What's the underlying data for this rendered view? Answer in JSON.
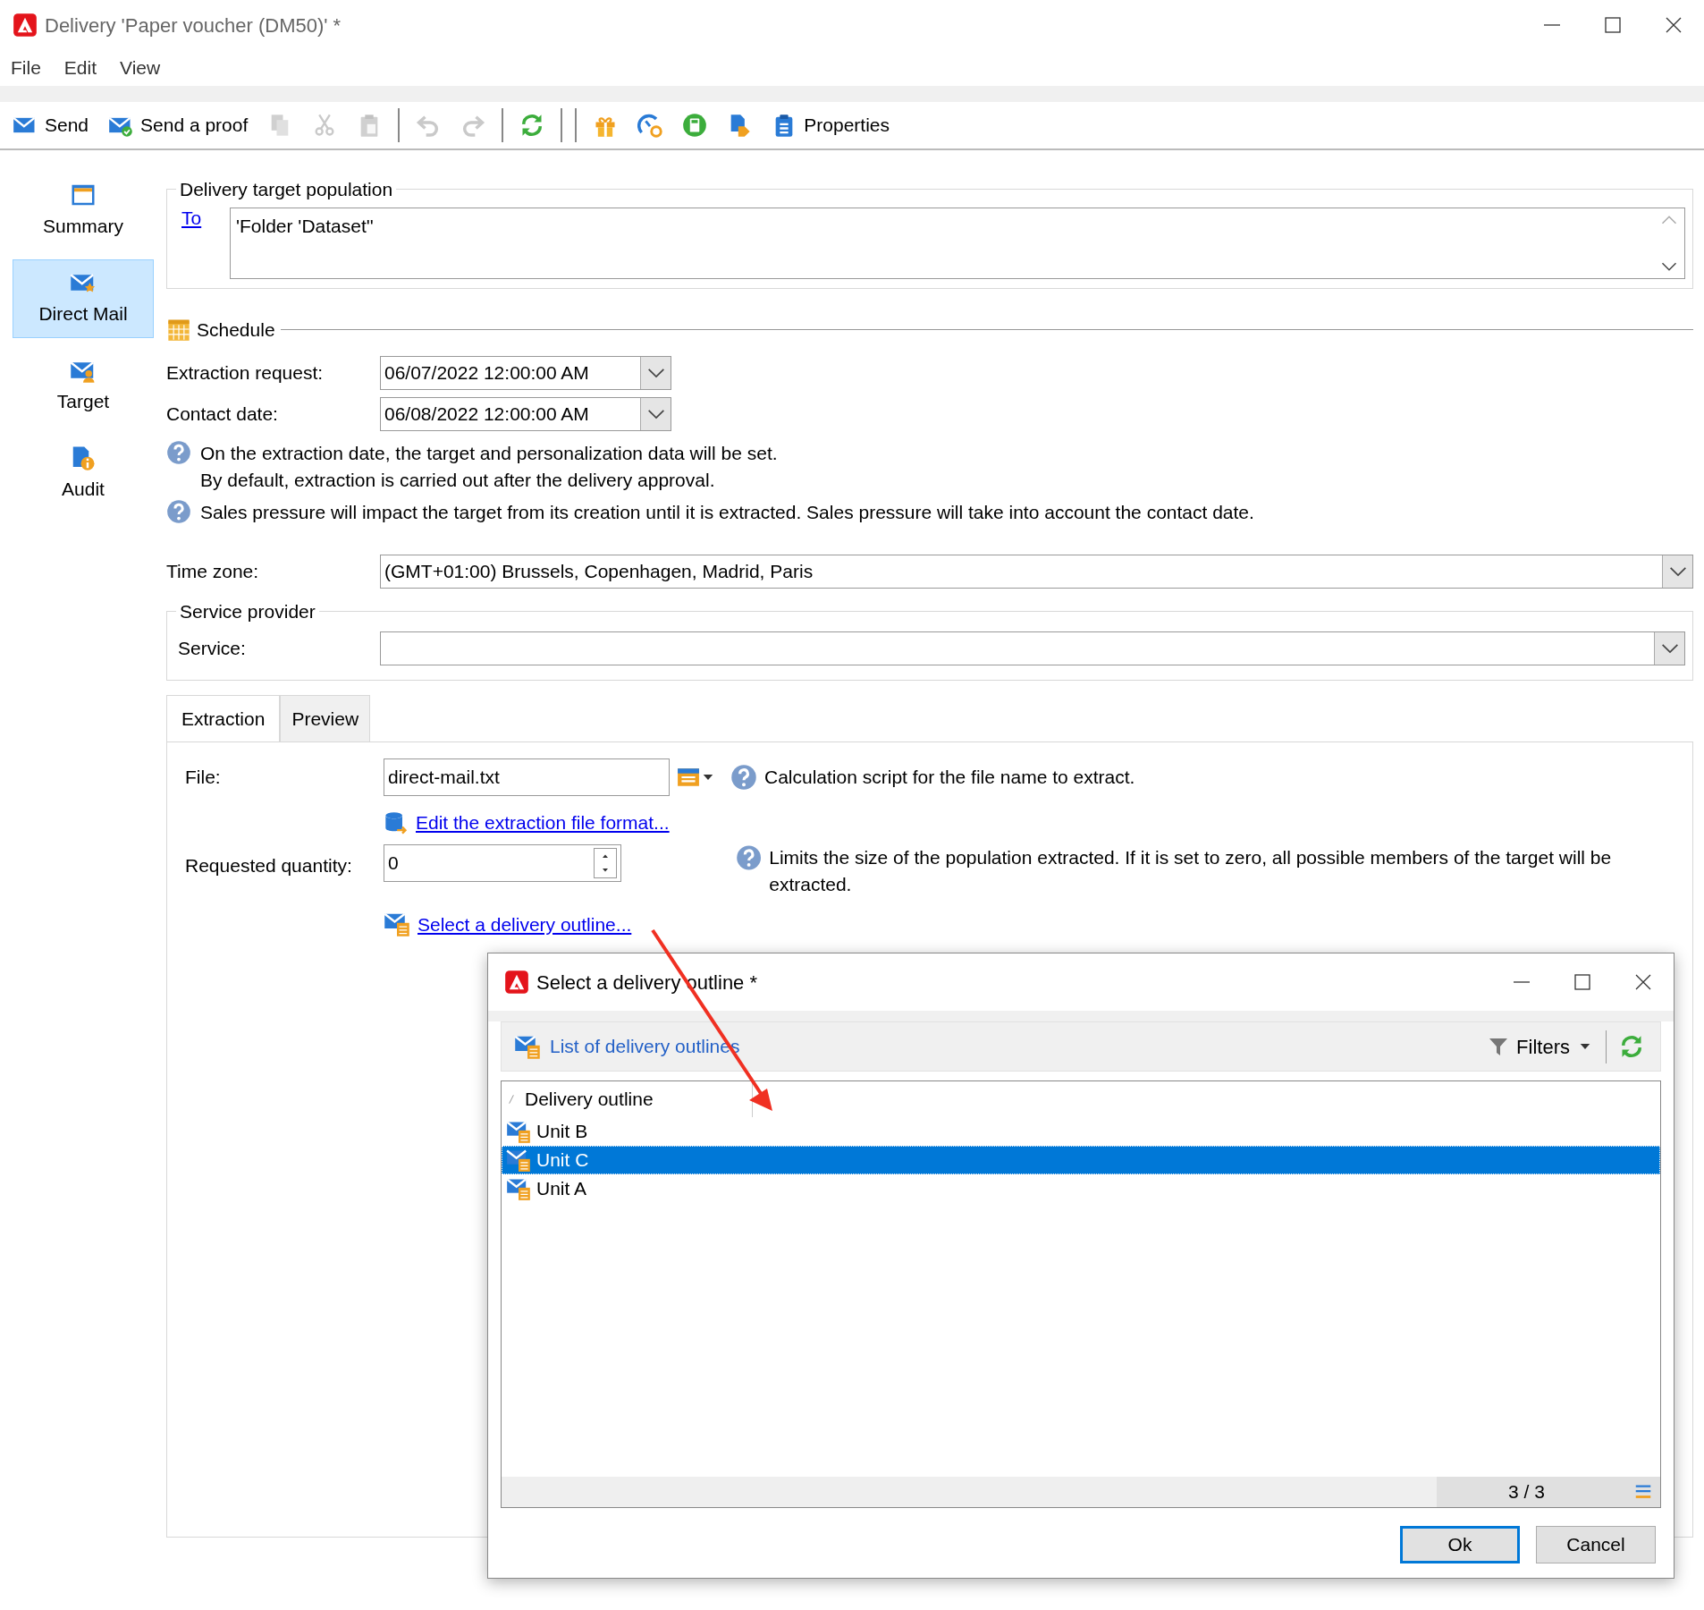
{
  "window": {
    "title": "Delivery 'Paper voucher (DM50)' *"
  },
  "menu": [
    "File",
    "Edit",
    "View"
  ],
  "toolbar": [
    {
      "kind": "labeled",
      "label": "Send",
      "disabled": false
    },
    {
      "kind": "labeled",
      "label": "Send a proof",
      "disabled": false
    },
    {
      "kind": "icon",
      "disabled": true
    },
    {
      "kind": "icon",
      "disabled": true
    },
    {
      "kind": "icon",
      "disabled": true
    },
    {
      "kind": "separator"
    },
    {
      "kind": "icon",
      "disabled": true
    },
    {
      "kind": "icon",
      "disabled": true
    },
    {
      "kind": "separator"
    },
    {
      "kind": "icon",
      "disabled": false
    },
    {
      "kind": "separator"
    },
    {
      "kind": "separator"
    },
    {
      "kind": "icon",
      "disabled": false
    },
    {
      "kind": "icon",
      "disabled": false
    },
    {
      "kind": "icon",
      "disabled": false
    },
    {
      "kind": "icon",
      "disabled": false
    },
    {
      "kind": "labeled",
      "label": "Properties",
      "disabled": false
    }
  ],
  "sidebar": {
    "items": [
      {
        "label": "Summary",
        "selected": false
      },
      {
        "label": "Direct Mail",
        "selected": true
      },
      {
        "label": "Target",
        "selected": false
      },
      {
        "label": "Audit",
        "selected": false
      }
    ]
  },
  "target_population": {
    "legend": "Delivery target population",
    "link": "To",
    "value": "'Folder 'Dataset''"
  },
  "schedule": {
    "title": "Schedule",
    "fields": [
      {
        "label": "Extraction request:",
        "value": "06/07/2022 12:00:00 AM"
      },
      {
        "label": "Contact date:",
        "value": "06/08/2022 12:00:00 AM"
      }
    ],
    "notes": [
      "On the extraction date, the target and personalization data will be set.\nBy default, extraction is carried out after the delivery approval.",
      "Sales pressure will impact the target from its creation until it is extracted. Sales pressure will take into account the contact date."
    ]
  },
  "time_zone": {
    "label": "Time zone:",
    "value": "(GMT+01:00) Brussels, Copenhagen, Madrid, Paris"
  },
  "service_provider": {
    "legend": "Service provider",
    "label": "Service:"
  },
  "tabs": [
    {
      "label": "Extraction",
      "selected": true
    },
    {
      "label": "Preview",
      "selected": false
    }
  ],
  "extraction": {
    "file_label": "File:",
    "file_value": "direct-mail.txt",
    "file_help": "Calculation script for the file name to extract.",
    "format_link": "Edit the extraction file format...",
    "quantity_label": "Requested quantity:",
    "quantity_value": "0",
    "quantity_help": "Limits the size of the population extracted. If it is set to zero, all possible members of the target will be extracted.",
    "outline_link": "Select a delivery outline..."
  },
  "dialog": {
    "title": "Select a delivery outline *",
    "list_title": "List of delivery outlines",
    "filters": "Filters",
    "column": "Delivery outline",
    "rows": [
      {
        "label": "Unit B",
        "selected": false
      },
      {
        "label": "Unit C",
        "selected": true
      },
      {
        "label": "Unit A",
        "selected": false
      }
    ],
    "count": "3 / 3",
    "buttons": [
      {
        "label": "Ok",
        "focused": true
      },
      {
        "label": "Cancel",
        "focused": false
      }
    ]
  }
}
